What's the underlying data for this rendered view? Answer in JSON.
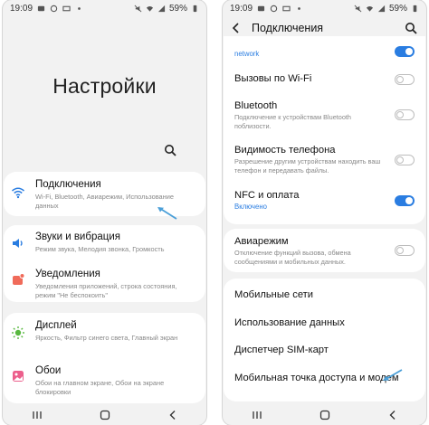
{
  "left": {
    "status": {
      "time": "19:09",
      "battery": "59%"
    },
    "title": "Настройки",
    "groups": [
      {
        "items": [
          {
            "title": "Подключения",
            "subtitle": "Wi-Fi, Bluetooth, Авиарежим, Использование данных",
            "icon": "wifi-icon"
          }
        ]
      },
      {
        "items": [
          {
            "title": "Звуки и вибрация",
            "subtitle": "Режим звука, Мелодия звонка, Громкость",
            "icon": "volume-icon"
          },
          {
            "title": "Уведомления",
            "subtitle": "Уведомления приложений, строка состояния, режим \"Не беспокоить\"",
            "icon": "notification-icon"
          }
        ]
      },
      {
        "items": [
          {
            "title": "Дисплей",
            "subtitle": "Яркость, Фильтр синего света, Главный экран",
            "icon": "display-icon"
          },
          {
            "title": "Обои",
            "subtitle": "Обои на главном экране, Обои на экране блокировки",
            "icon": "wallpaper-icon"
          }
        ]
      }
    ]
  },
  "right": {
    "status": {
      "time": "19:09",
      "battery": "59%"
    },
    "header": {
      "title": "Подключения"
    },
    "items": [
      {
        "title": "",
        "subtitle": "network",
        "toggle": "on"
      },
      {
        "title": "Вызовы по Wi-Fi",
        "subtitle": "",
        "toggle": "off"
      },
      {
        "title": "Bluetooth",
        "subtitle": "Подключение к устройствам Bluetooth поблизости.",
        "toggle": "off"
      },
      {
        "title": "Видимость телефона",
        "subtitle": "Разрешение другим устройствам находить ваш телефон и передавать файлы.",
        "toggle": "off"
      },
      {
        "title": "NFC и оплата",
        "subtitle": "Включено",
        "toggle": "on"
      },
      {
        "title": "Авиарежим",
        "subtitle": "Отключение функций вызова, обмена сообщениями и мобильных данных.",
        "toggle": "off"
      }
    ],
    "more": [
      "Мобильные сети",
      "Использование данных",
      "Диспетчер SIM-карт",
      "Мобильная точка доступа и модем"
    ]
  },
  "colors": {
    "accent": "#2a7de1",
    "background": "#f2f2f2",
    "card": "#ffffff"
  }
}
